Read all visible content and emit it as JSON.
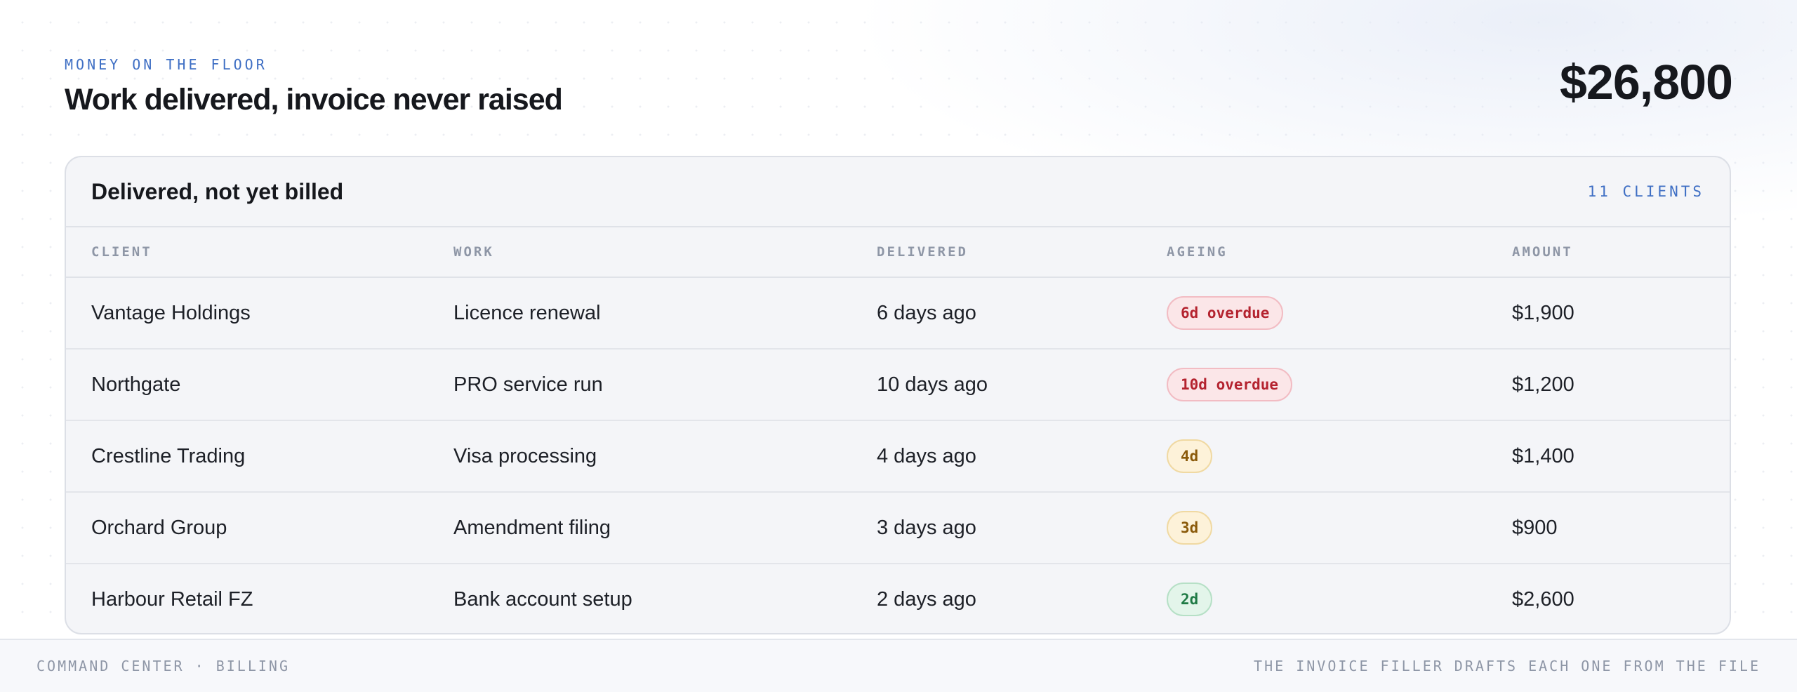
{
  "header": {
    "eyebrow": "MONEY ON THE FLOOR",
    "title": "Work delivered, invoice never raised",
    "total": "$26,800"
  },
  "card": {
    "title": "Delivered, not yet billed",
    "count": "11 CLIENTS",
    "columns": [
      "CLIENT",
      "WORK",
      "DELIVERED",
      "AGEING",
      "AMOUNT"
    ],
    "rows": [
      {
        "client": "Vantage Holdings",
        "work": "Licence renewal",
        "delivered": "6 days ago",
        "ageing": "6d overdue",
        "ageing_status": "overdue",
        "amount": "$1,900"
      },
      {
        "client": "Northgate",
        "work": "PRO service run",
        "delivered": "10 days ago",
        "ageing": "10d overdue",
        "ageing_status": "overdue",
        "amount": "$1,200"
      },
      {
        "client": "Crestline Trading",
        "work": "Visa processing",
        "delivered": "4 days ago",
        "ageing": "4d",
        "ageing_status": "warning",
        "amount": "$1,400"
      },
      {
        "client": "Orchard Group",
        "work": "Amendment filing",
        "delivered": "3 days ago",
        "ageing": "3d",
        "ageing_status": "warning",
        "amount": "$900"
      },
      {
        "client": "Harbour Retail FZ",
        "work": "Bank account setup",
        "delivered": "2 days ago",
        "ageing": "2d",
        "ageing_status": "ok",
        "amount": "$2,600"
      }
    ]
  },
  "footer": {
    "left": "COMMAND CENTER · BILLING",
    "right": "THE INVOICE FILLER DRAFTS EACH ONE FROM THE FILE"
  },
  "colors": {
    "accent": "#3f6fc4",
    "overdue": "#b4232f",
    "warning": "#8a5a0a",
    "ok": "#1f7a45"
  }
}
